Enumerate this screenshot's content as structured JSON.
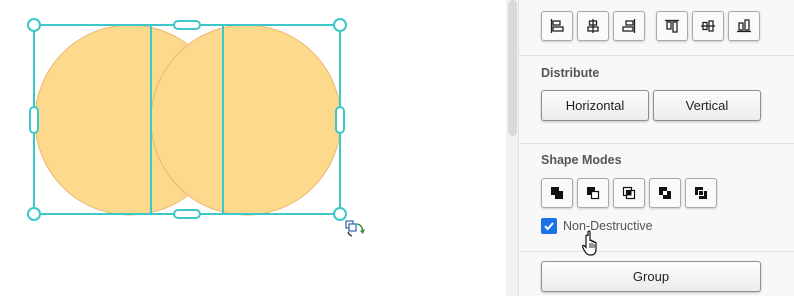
{
  "canvas": {
    "shapes": [
      {
        "type": "circle",
        "fill": "#fdd98e",
        "stroke": "#e9b868"
      },
      {
        "type": "circle",
        "fill": "#fdd98e",
        "stroke": "#e9b868"
      }
    ],
    "selection_color": "#3cc8c8",
    "duplicate_icon": "duplicate-icon",
    "rotate_icon": "rotate-icon"
  },
  "panel": {
    "align": {
      "buttons": [
        {
          "icon": "align-left-icon"
        },
        {
          "icon": "align-center-horizontal-icon"
        },
        {
          "icon": "align-right-icon"
        },
        {
          "icon": "align-top-icon"
        },
        {
          "icon": "align-center-vertical-icon"
        },
        {
          "icon": "align-bottom-icon"
        }
      ]
    },
    "distribute": {
      "title": "Distribute",
      "horizontal_label": "Horizontal",
      "vertical_label": "Vertical"
    },
    "shape_modes": {
      "title": "Shape Modes",
      "modes": [
        {
          "icon": "unite-icon"
        },
        {
          "icon": "minus-front-icon"
        },
        {
          "icon": "intersect-icon"
        },
        {
          "icon": "exclude-icon"
        },
        {
          "icon": "divide-icon"
        }
      ],
      "non_destructive": {
        "label": "Non-Destructive",
        "checked": true
      }
    },
    "group": {
      "label": "Group"
    }
  },
  "colors": {
    "accent": "#1a73e8",
    "panel_bg": "#f8f8f8"
  }
}
